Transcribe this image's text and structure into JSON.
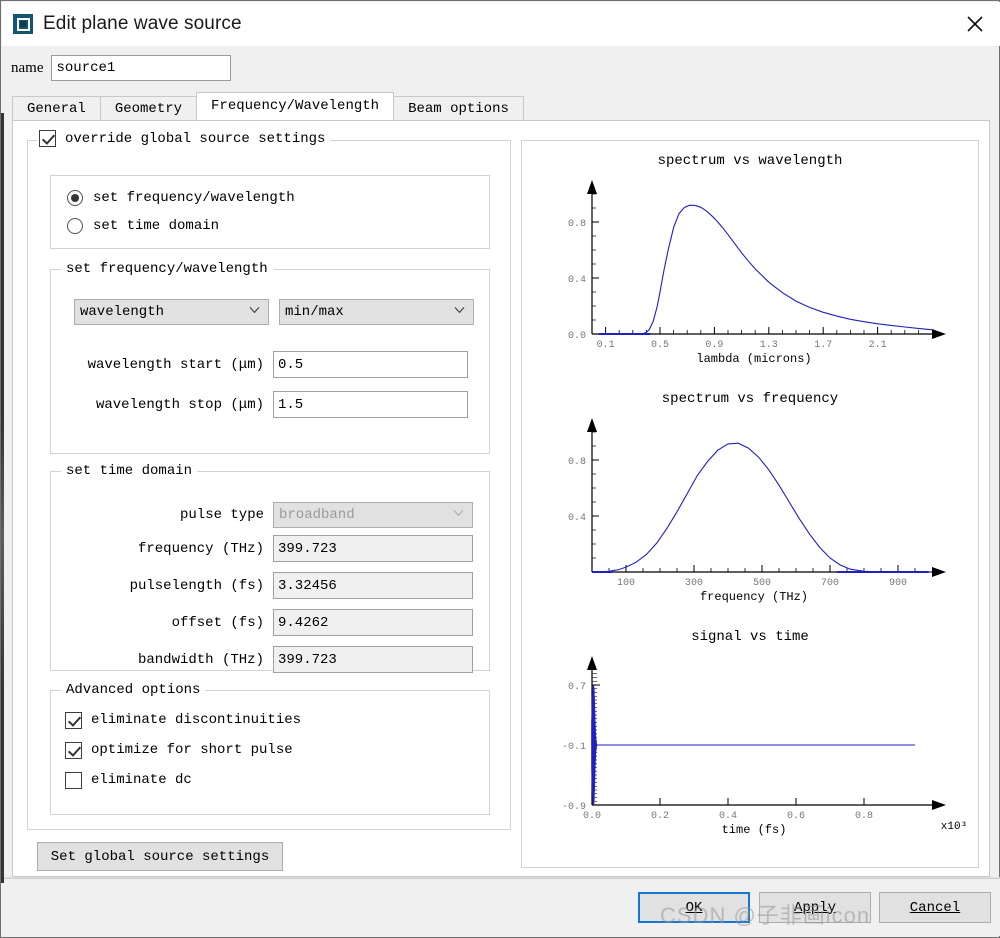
{
  "window": {
    "title": "Edit plane wave source",
    "icon": "plane-wave-source-icon",
    "close_icon": "close-icon"
  },
  "name_field": {
    "label": "name",
    "value": "source1",
    "placeholder": ""
  },
  "tabs": [
    {
      "label": "General",
      "active": false
    },
    {
      "label": "Geometry",
      "active": false
    },
    {
      "label": "Frequency/Wavelength",
      "active": true
    },
    {
      "label": "Beam options",
      "active": false
    }
  ],
  "override": {
    "label": "override global source settings",
    "checked": true
  },
  "mode_radios": [
    {
      "label": "set frequency/wavelength",
      "selected": true
    },
    {
      "label": "set time domain",
      "selected": false
    }
  ],
  "freq_wave_group": {
    "title": "set frequency/wavelength",
    "quantity_combo": {
      "value": "wavelength",
      "icon": "chevron-down-icon"
    },
    "range_combo": {
      "value": "min/max",
      "icon": "chevron-down-icon"
    },
    "start": {
      "label": "wavelength start (μm)",
      "value": "0.5"
    },
    "stop": {
      "label": "wavelength stop (μm)",
      "value": "1.5"
    }
  },
  "time_domain_group": {
    "title": "set time domain",
    "pulse_type": {
      "label": "pulse type",
      "value": "broadband",
      "icon": "chevron-down-icon",
      "disabled": true
    },
    "frequency": {
      "label": "frequency (THz)",
      "value": "399.723"
    },
    "pulselength": {
      "label": "pulselength (fs)",
      "value": "3.32456"
    },
    "offset": {
      "label": "offset (fs)",
      "value": "9.4262"
    },
    "bandwidth": {
      "label": "bandwidth (THz)",
      "value": "399.723"
    }
  },
  "advanced_group": {
    "title": "Advanced options",
    "options": [
      {
        "label": "eliminate discontinuities",
        "checked": true
      },
      {
        "label": "optimize for short pulse",
        "checked": true
      },
      {
        "label": "eliminate dc",
        "checked": false
      }
    ]
  },
  "set_global_button": {
    "label": "Set global source settings"
  },
  "footer": {
    "ok": "OK",
    "apply": "Apply",
    "cancel": "Cancel"
  },
  "watermark": "CSDN @子非画icon",
  "colors": {
    "curve": "#2020c0",
    "accent": "#1477d4",
    "icon": "#14566b",
    "axis": "#000000",
    "tick_text": "#777777"
  },
  "chart_data": [
    {
      "type": "line",
      "title": "spectrum vs wavelength",
      "xlabel": "lambda (microns)",
      "ylabel": "",
      "xlim": [
        0.0,
        2.5
      ],
      "ylim": [
        0.0,
        1.0
      ],
      "xticks": [
        "0.1",
        "0.5",
        "0.9",
        "1.3",
        "1.7",
        "2.1"
      ],
      "xtick_values": [
        0.1,
        0.5,
        0.9,
        1.3,
        1.7,
        2.1
      ],
      "yticks": [
        "0.0",
        "0.4",
        "0.8"
      ],
      "ytick_values": [
        0.0,
        0.4,
        0.8
      ],
      "grid": false,
      "legend": "none",
      "x": [
        0.05,
        0.1,
        0.15,
        0.2,
        0.25,
        0.3,
        0.35,
        0.38,
        0.4,
        0.42,
        0.45,
        0.48,
        0.5,
        0.53,
        0.56,
        0.6,
        0.64,
        0.68,
        0.72,
        0.76,
        0.8,
        0.84,
        0.88,
        0.92,
        0.96,
        1.0,
        1.05,
        1.1,
        1.15,
        1.2,
        1.3,
        1.4,
        1.5,
        1.6,
        1.7,
        1.8,
        1.9,
        2.0,
        2.1,
        2.2,
        2.3,
        2.4,
        2.5
      ],
      "y": [
        0.0,
        0.0,
        0.0,
        0.0,
        0.0,
        0.0,
        0.001,
        0.004,
        0.012,
        0.03,
        0.09,
        0.2,
        0.3,
        0.46,
        0.6,
        0.76,
        0.86,
        0.905,
        0.92,
        0.918,
        0.905,
        0.88,
        0.845,
        0.805,
        0.76,
        0.71,
        0.645,
        0.58,
        0.52,
        0.465,
        0.37,
        0.295,
        0.235,
        0.19,
        0.155,
        0.128,
        0.105,
        0.088,
        0.073,
        0.061,
        0.05,
        0.04,
        0.03
      ]
    },
    {
      "type": "line",
      "title": "spectrum vs frequency",
      "xlabel": "frequency (THz)",
      "ylabel": "",
      "xlim": [
        0,
        1000
      ],
      "ylim": [
        0.0,
        1.0
      ],
      "xticks": [
        "100",
        "300",
        "500",
        "700",
        "900"
      ],
      "xtick_values": [
        100,
        300,
        500,
        700,
        900
      ],
      "yticks": [
        "0.4",
        "0.8"
      ],
      "ytick_values": [
        0.4,
        0.8
      ],
      "grid": false,
      "legend": "none",
      "x": [
        0,
        50,
        80,
        100,
        130,
        160,
        190,
        220,
        250,
        280,
        310,
        340,
        370,
        400,
        430,
        460,
        490,
        520,
        550,
        580,
        610,
        640,
        670,
        700,
        730,
        760,
        800,
        850,
        900,
        1000
      ],
      "y": [
        0.0,
        0.005,
        0.018,
        0.035,
        0.07,
        0.125,
        0.205,
        0.31,
        0.43,
        0.56,
        0.69,
        0.79,
        0.87,
        0.915,
        0.92,
        0.885,
        0.82,
        0.73,
        0.62,
        0.5,
        0.38,
        0.27,
        0.175,
        0.1,
        0.05,
        0.02,
        0.005,
        0.0,
        0.0,
        0.0
      ]
    },
    {
      "type": "line",
      "title": "signal vs time",
      "xlabel": "time (fs)",
      "ylabel": "",
      "x_exponent": "x10³",
      "xlim": [
        0.0,
        1.0
      ],
      "ylim": [
        -0.9,
        0.9
      ],
      "xticks": [
        "0.0",
        "0.2",
        "0.4",
        "0.6",
        "0.8"
      ],
      "xtick_values": [
        0.0,
        0.2,
        0.4,
        0.6,
        0.8
      ],
      "yticks": [
        "0.7",
        "-0.1",
        "-0.9"
      ],
      "ytick_values": [
        0.7,
        -0.1,
        -0.9
      ],
      "grid": false,
      "legend": "none",
      "description": "dense oscillation burst confined to t ~ 0, decaying to a flat baseline at -0.1 for the remainder of the window",
      "burst_x_range": [
        0.0,
        0.01
      ],
      "burst_amplitude": 0.8,
      "baseline": -0.1
    }
  ]
}
